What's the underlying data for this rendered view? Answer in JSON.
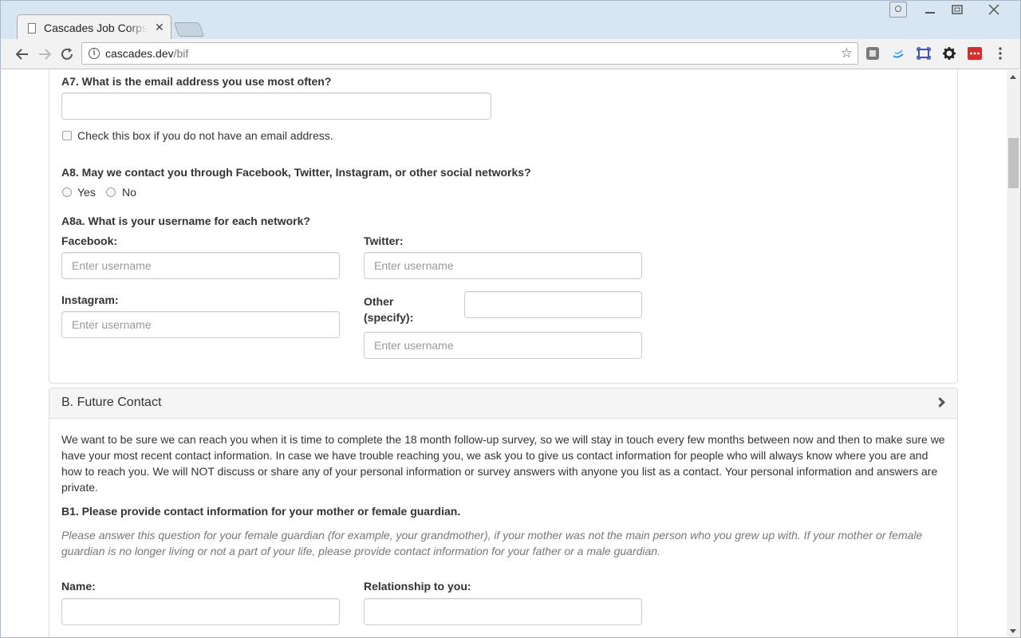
{
  "browser": {
    "tab_title": "Cascades Job Corps",
    "tab_close": "✕",
    "url_host": "cascades.dev",
    "url_path": "/bif",
    "colors": {
      "extension_red": "#d32f2f",
      "extension_blue": "#2196f3"
    }
  },
  "section_a": {
    "a7": {
      "question": "A7. What is the email address you use most often?",
      "email_value": "",
      "no_email_label": "Check this box if you do not have an email address."
    },
    "a8": {
      "question": "A8. May we contact you through Facebook, Twitter, Instagram, or other social networks?",
      "yes_label": "Yes",
      "no_label": "No"
    },
    "a8a": {
      "question": "A8a. What is your username for each network?",
      "facebook_label": "Facebook:",
      "twitter_label": "Twitter:",
      "instagram_label": "Instagram:",
      "other_label_line1": "Other",
      "other_label_line2": "(specify):",
      "placeholder": "Enter username",
      "other_specify_value": ""
    }
  },
  "section_b": {
    "title": "B. Future Contact",
    "intro": "We want to be sure we can reach you when it is time to complete the 18 month follow-up survey, so we will stay in touch every few months between now and then to make sure we have your most recent contact information. In case we have trouble reaching you, we ask you to give us contact information for people who will always know where you are and how to reach you. We will NOT discuss or share any of your personal information or survey answers with anyone you list as a contact. Your personal information and answers are private.",
    "b1": {
      "question": "B1. Please provide contact information for your mother or female guardian.",
      "help": "Please answer this question for your female guardian (for example, your grandmother), if your mother was not the main person who you grew up with. If your mother or female guardian is no longer living or not a part of your life, please provide contact information for your father or a male guardian.",
      "name_label": "Name:",
      "relationship_label": "Relationship to you:"
    }
  }
}
